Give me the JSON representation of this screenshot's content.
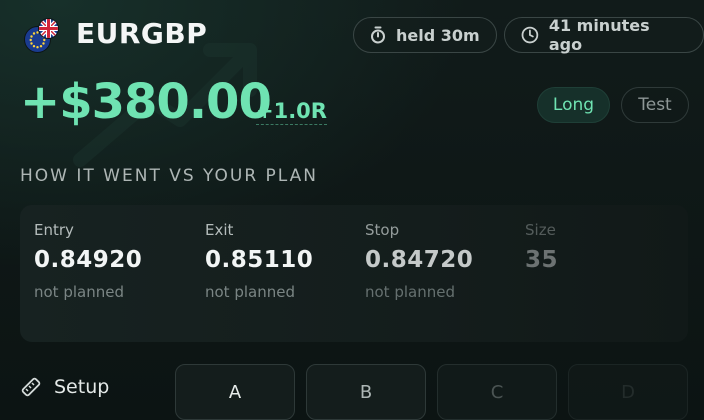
{
  "header": {
    "symbol": "EURGBP",
    "flags": [
      "eu-flag-icon",
      "uk-flag-icon"
    ],
    "held_label": "held 30m",
    "time_ago_label": "41 minutes ago",
    "icons": {
      "held": "stopwatch-icon",
      "time_ago": "clock-icon"
    }
  },
  "result": {
    "pnl": "+$380.00",
    "r_multiple": "+1.0R",
    "direction_tag": "Long",
    "account_tag": "Test"
  },
  "colors": {
    "profit": "#6fe3b2",
    "background": "#0d1514",
    "card": "#172221"
  },
  "plan_section": {
    "title": "HOW IT WENT VS YOUR PLAN",
    "stats": [
      {
        "label": "Entry",
        "value": "0.84920",
        "note": "not planned"
      },
      {
        "label": "Exit",
        "value": "0.85110",
        "note": "not planned"
      },
      {
        "label": "Stop",
        "value": "0.84720",
        "note": "not planned"
      },
      {
        "label": "Size",
        "value": "35",
        "note": ""
      }
    ]
  },
  "setup": {
    "label": "Setup",
    "icon": "ruler-icon",
    "options": [
      "A",
      "B",
      "C",
      "D"
    ]
  }
}
